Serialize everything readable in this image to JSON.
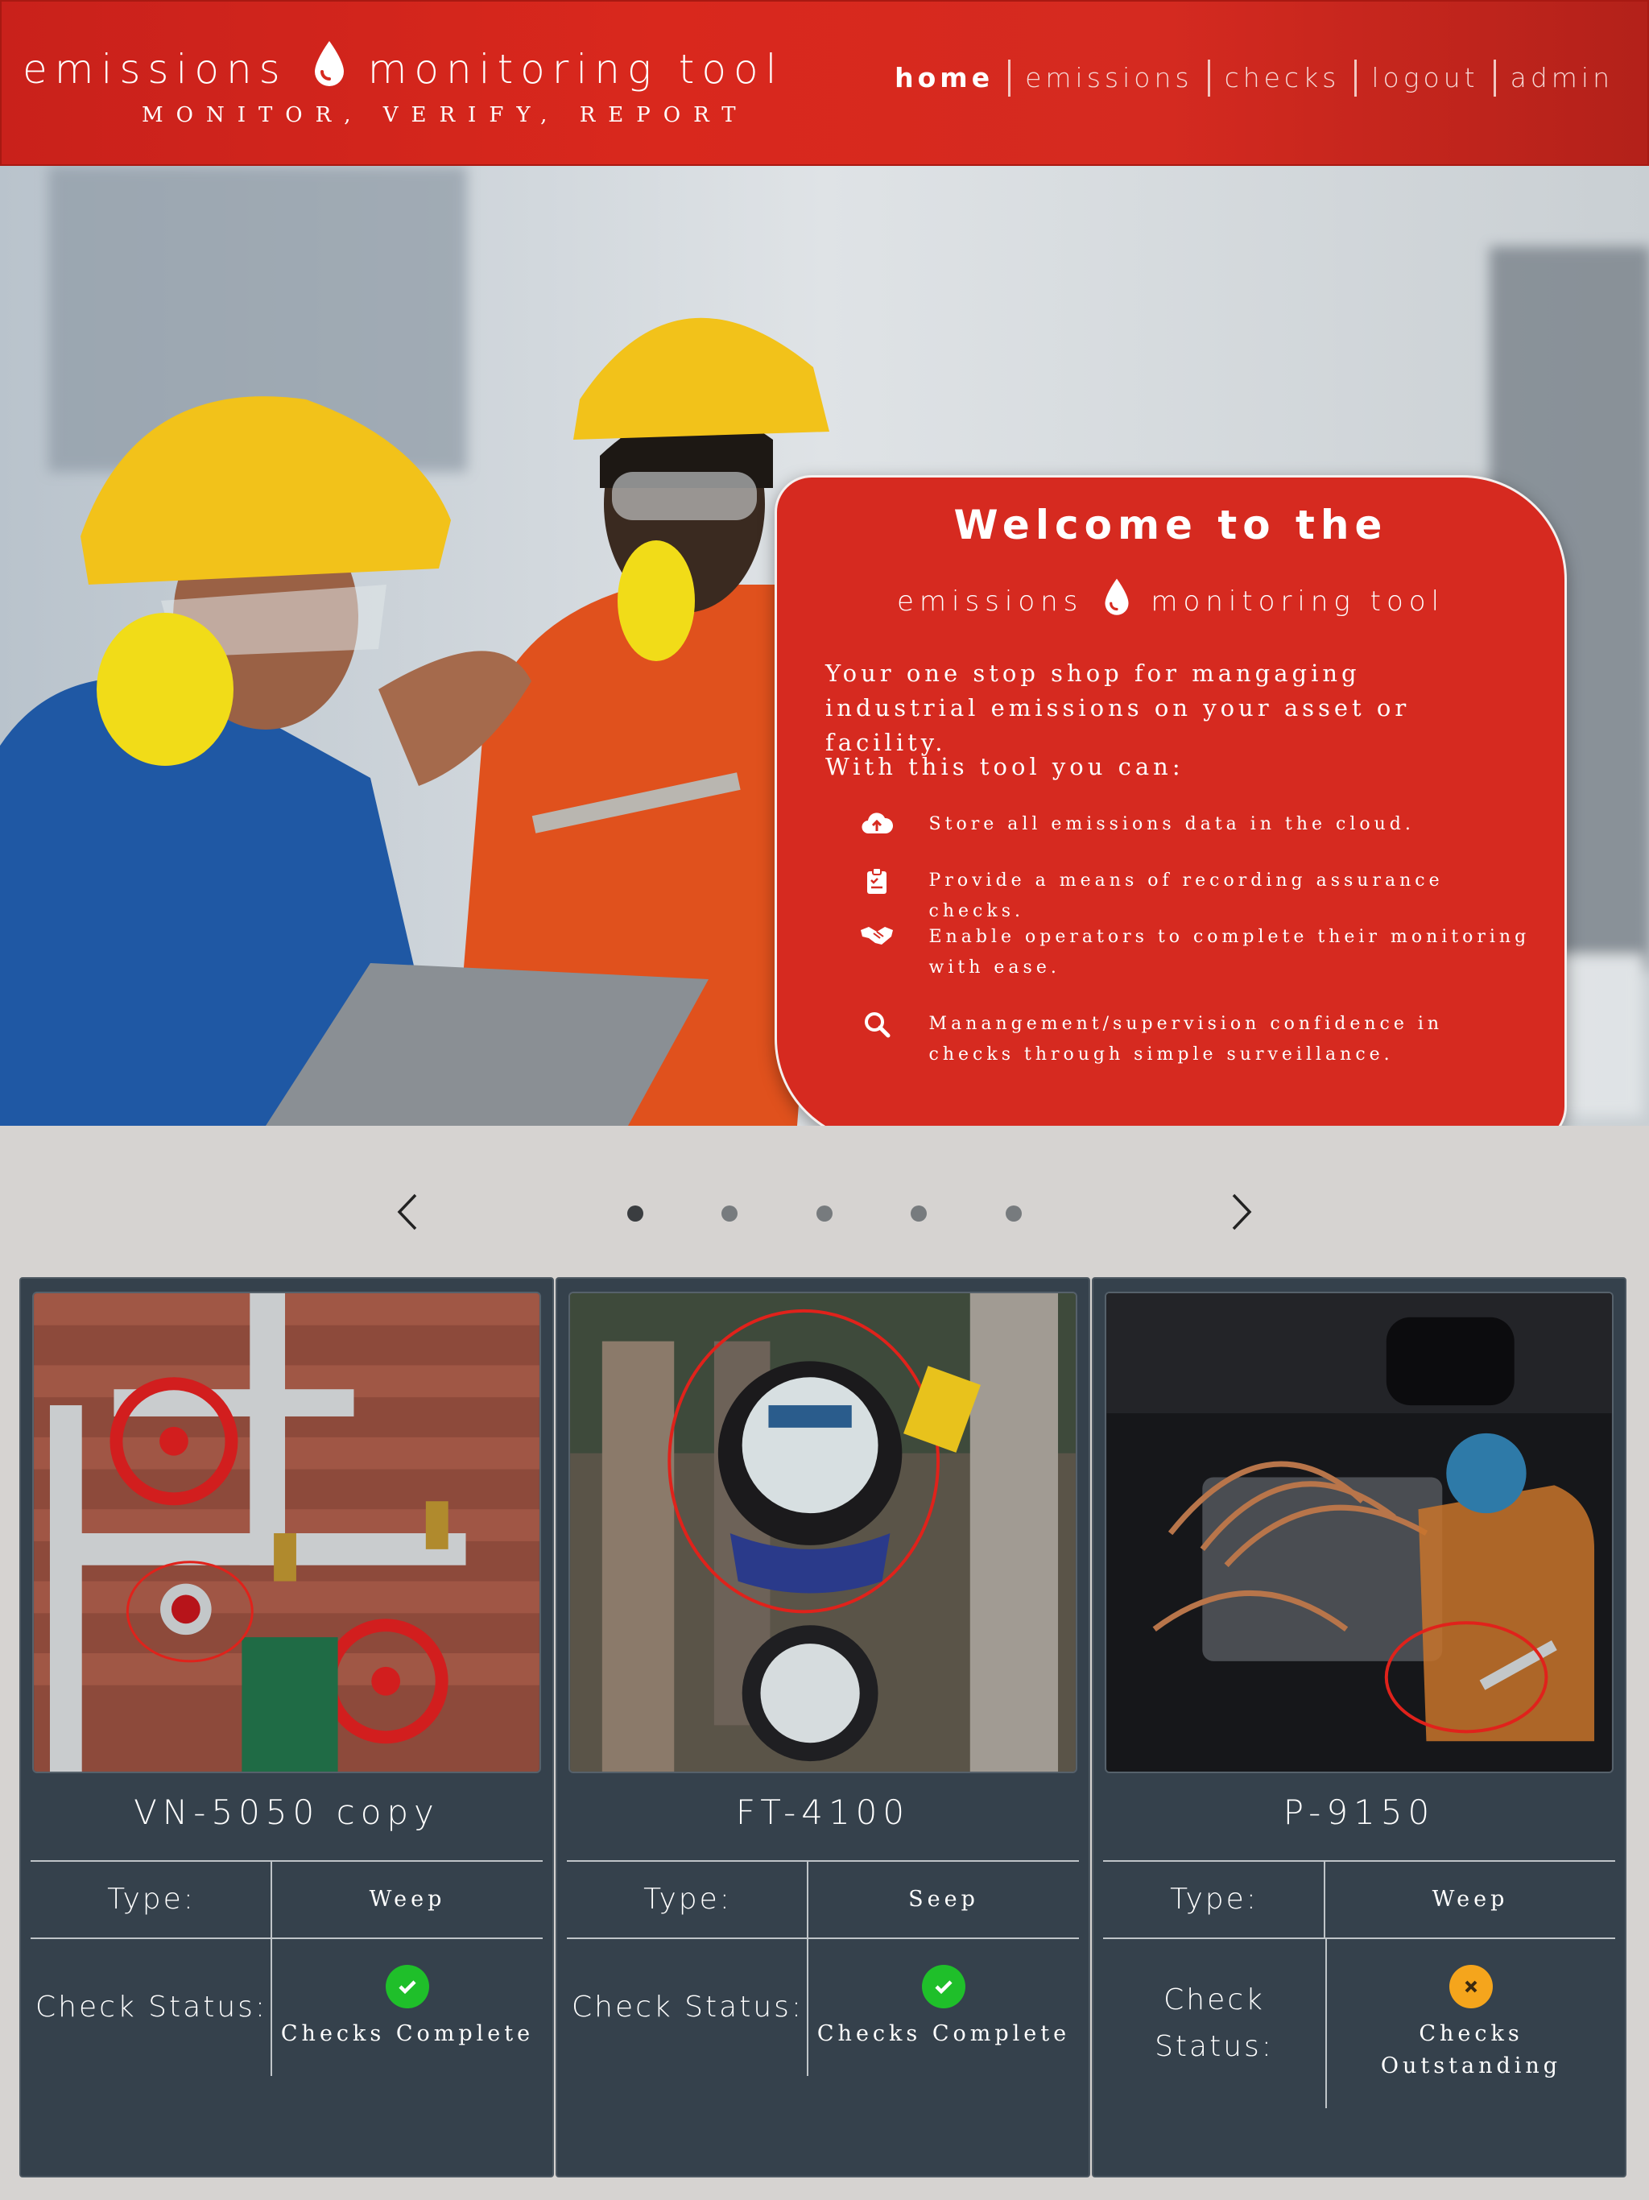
{
  "header": {
    "title_left": "emissions",
    "title_right": "monitoring tool",
    "tagline": "MONITOR, VERIFY, REPORT",
    "brand_color": "#d62a20"
  },
  "nav": {
    "items": [
      {
        "label": "home",
        "active": true
      },
      {
        "label": "emissions",
        "active": false
      },
      {
        "label": "checks",
        "active": false
      },
      {
        "label": "logout",
        "active": false
      },
      {
        "label": "admin",
        "active": false
      }
    ]
  },
  "welcome": {
    "title": "Welcome to the",
    "brand_left": "emissions",
    "brand_right": "monitoring tool",
    "intro": "Your one stop shop for mangaging industrial emissions on your asset or facility.",
    "with": "With this tool you can:",
    "features": [
      {
        "icon": "cloud-upload-icon",
        "text": "Store all emissions data in the cloud."
      },
      {
        "icon": "clipboard-check-icon",
        "text": "Provide a means of recording assurance checks."
      },
      {
        "icon": "handshake-icon",
        "text": "Enable operators to complete their monitoring with ease."
      },
      {
        "icon": "search-icon",
        "text": "Manangement/supervision confidence in checks through simple surveillance."
      }
    ]
  },
  "carousel": {
    "slide_count": 5,
    "active_index": 0
  },
  "cards": [
    {
      "name": "VN-5050 copy",
      "type_label": "Type:",
      "type_value": "Weep",
      "status_label": "Check Status:",
      "status_value": "Checks Complete",
      "status_icon": "check-icon",
      "status_color": "#1fbf2a"
    },
    {
      "name": "FT-4100",
      "type_label": "Type:",
      "type_value": "Seep",
      "status_label": "Check Status:",
      "status_value": "Checks Complete",
      "status_icon": "check-icon",
      "status_color": "#1fbf2a"
    },
    {
      "name": "P-9150",
      "type_label": "Type:",
      "type_value": "Weep",
      "status_label": "Check Status:",
      "status_value": "Checks Outstanding",
      "status_icon": "x-icon",
      "status_color": "#f5a51c"
    }
  ]
}
